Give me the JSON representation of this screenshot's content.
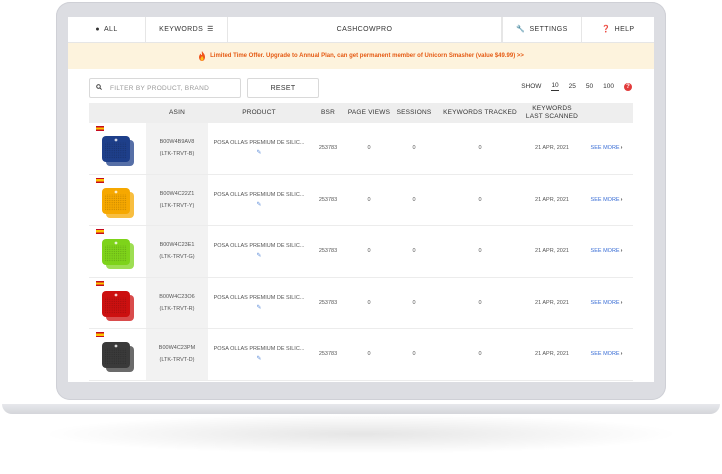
{
  "nav": {
    "all": "ALL",
    "keywords": "KEYWORDS",
    "brand": "CASHCOWPRO",
    "settings": "SETTINGS",
    "help": "HELP"
  },
  "banner": {
    "text": "Limited Time Offer. Upgrade to Annual Plan, can get permanent member of Unicorn Smasher (value $49.99) >>"
  },
  "toolbar": {
    "search_placeholder": "FILTER BY PRODUCT, BRAND",
    "reset_label": "RESET",
    "show_label": "SHOW",
    "show_options": [
      "10",
      "25",
      "50",
      "100"
    ],
    "show_selected": "10"
  },
  "table": {
    "headers": {
      "asin": "ASIN",
      "product": "PRODUCT",
      "bsr": "BSR",
      "page_views": "PAGE VIEWS",
      "sessions": "SESSIONS",
      "keywords_tracked": "KEYWORDS TRACKED",
      "keywords_last_scanned_1": "KEYWORDS",
      "keywords_last_scanned_2": "LAST SCANNED"
    },
    "rows": [
      {
        "asin": "B00W4B9AV8",
        "sku": "(LTK-TRVT-B)",
        "product": "POSA OLLAS PREMIUM DE SILIC...",
        "bsr": "253783",
        "views": "0",
        "sessions": "0",
        "keywords": "0",
        "last": "21 APR, 2021",
        "more": "SEE MORE",
        "color": "#1e3f8a"
      },
      {
        "asin": "B00W4C22Z1",
        "sku": "(LTK-TRVT-Y)",
        "product": "POSA OLLAS PREMIUM DE SILIC...",
        "bsr": "253783",
        "views": "0",
        "sessions": "0",
        "keywords": "0",
        "last": "21 APR, 2021",
        "more": "SEE MORE",
        "color": "#f6a800"
      },
      {
        "asin": "B00W4C23E1",
        "sku": "(LTK-TRVT-G)",
        "product": "POSA OLLAS PREMIUM DE SILIC...",
        "bsr": "253783",
        "views": "0",
        "sessions": "0",
        "keywords": "0",
        "last": "21 APR, 2021",
        "more": "SEE MORE",
        "color": "#7ed31a"
      },
      {
        "asin": "B00W4C23O6",
        "sku": "(LTK-TRVT-R)",
        "product": "POSA OLLAS PREMIUM DE SILIC...",
        "bsr": "253783",
        "views": "0",
        "sessions": "0",
        "keywords": "0",
        "last": "21 APR, 2021",
        "more": "SEE MORE",
        "color": "#cc1010"
      },
      {
        "asin": "B00W4C23PM",
        "sku": "(LTK-TRVT-D)",
        "product": "POSA OLLAS PREMIUM DE SILIC...",
        "bsr": "253783",
        "views": "0",
        "sessions": "0",
        "keywords": "0",
        "last": "21 APR, 2021",
        "more": "SEE MORE",
        "color": "#3a3a3a"
      }
    ]
  },
  "colors": {
    "banner_bg": "#fdf3dd",
    "banner_text": "#e55b14",
    "link": "#3b6fd6"
  }
}
